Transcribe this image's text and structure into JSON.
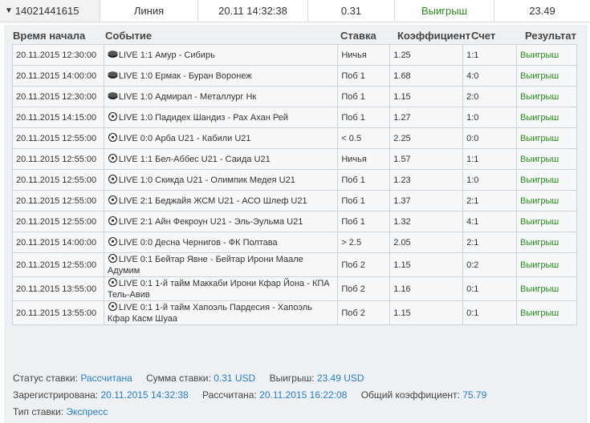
{
  "summary": {
    "bet_id": "14021441615",
    "type": "Линия",
    "datetime": "20.11 14:32:38",
    "stake": "0.31",
    "status": "Выигрыш",
    "win": "23.49"
  },
  "headers": {
    "start": "Время начала",
    "event": "Событие",
    "bet": "Ставка",
    "coef": "Коэффициент",
    "score": "Счет",
    "result": "Результат"
  },
  "rows": [
    {
      "time": "20.11.2015 12:30:00",
      "sport": "hockey",
      "event": "LIVE 1:1 Амур - Сибирь",
      "bet": "Ничья",
      "coef": "1.25",
      "score": "1:1",
      "result": "Выигрыш"
    },
    {
      "time": "20.11.2015 14:00:00",
      "sport": "hockey",
      "event": "LIVE 1:0 Ермак - Буран Воронеж",
      "bet": "Поб 1",
      "coef": "1.68",
      "score": "4:0",
      "result": "Выигрыш"
    },
    {
      "time": "20.11.2015 12:30:00",
      "sport": "hockey",
      "event": "LIVE 1:0 Адмирал - Металлург Нк",
      "bet": "Поб 1",
      "coef": "1.15",
      "score": "2:0",
      "result": "Выигрыш"
    },
    {
      "time": "20.11.2015 14:15:00",
      "sport": "football",
      "event": "LIVE 1:0 Падидех Шандиз - Рах Ахан Рей",
      "bet": "Поб 1",
      "coef": "1.27",
      "score": "1:0",
      "result": "Выигрыш"
    },
    {
      "time": "20.11.2015 12:55:00",
      "sport": "football",
      "event": "LIVE 0:0 Арба U21 - Кабили U21",
      "bet": "< 0.5",
      "coef": "2.25",
      "score": "0:0",
      "result": "Выигрыш"
    },
    {
      "time": "20.11.2015 12:55:00",
      "sport": "football",
      "event": "LIVE 1:1 Бел-Аббес U21 - Саида U21",
      "bet": "Ничья",
      "coef": "1.57",
      "score": "1:1",
      "result": "Выигрыш"
    },
    {
      "time": "20.11.2015 12:55:00",
      "sport": "football",
      "event": "LIVE 1:0 Скикда U21 - Олимпик Медея U21",
      "bet": "Поб 1",
      "coef": "1.23",
      "score": "1:0",
      "result": "Выигрыш"
    },
    {
      "time": "20.11.2015 12:55:00",
      "sport": "football",
      "event": "LIVE 2:1 Беджайя ЖСМ U21 - АСО Шлеф U21",
      "bet": "Поб 1",
      "coef": "1.37",
      "score": "2:1",
      "result": "Выигрыш"
    },
    {
      "time": "20.11.2015 12:55:00",
      "sport": "football",
      "event": "LIVE 2:1 Айн Фекроун U21 - Эль-Эульма U21",
      "bet": "Поб 1",
      "coef": "1.32",
      "score": "4:1",
      "result": "Выигрыш"
    },
    {
      "time": "20.11.2015 14:00:00",
      "sport": "football",
      "event": "LIVE 0:0 Десна Чернигов - ФК Полтава",
      "bet": "> 2.5",
      "coef": "2.05",
      "score": "2:1",
      "result": "Выигрыш"
    },
    {
      "time": "20.11.2015 12:55:00",
      "sport": "football",
      "event": "LIVE 0:1 Бейтар Явне - Бейтар Ирони Маале Адумим",
      "bet": "Поб 2",
      "coef": "1.15",
      "score": "0:2",
      "result": "Выигрыш"
    },
    {
      "time": "20.11.2015 13:55:00",
      "sport": "football",
      "event": "LIVE 0:1 1-й тайм Маккаби Ирони Кфар Йона - КПА Тель-Авив",
      "bet": "Поб 2",
      "coef": "1.16",
      "score": "0:1",
      "result": "Выигрыш"
    },
    {
      "time": "20.11.2015 13:55:00",
      "sport": "football",
      "event": "LIVE 0:1 1-й тайм Хапоэль Пардесия - Хапоэль Кфар Касм Шуаа",
      "bet": "Поб 2",
      "coef": "1.15",
      "score": "0:1",
      "result": "Выигрыш"
    }
  ],
  "footer": {
    "status_label": "Статус ставки:",
    "status_value": "Рассчитана",
    "sum_label": "Сумма ставки:",
    "sum_value": "0.31 USD",
    "win_label": "Выигрыш:",
    "win_value": "23.49 USD",
    "registered_label": "Зарегистрирована:",
    "registered_value": "20.11.2015 14:32:38",
    "calculated_label": "Рассчитана:",
    "calculated_value": "20.11.2015 16:22:08",
    "total_coef_label": "Общий коэффициент:",
    "total_coef_value": "75.79",
    "bet_type_label": "Тип ставки:",
    "bet_type_value": "Экспресс"
  },
  "colors": {
    "win": "#2a8a1c",
    "link": "#2a7dc0",
    "panel": "#eef1f4",
    "border": "#ccd3da"
  }
}
